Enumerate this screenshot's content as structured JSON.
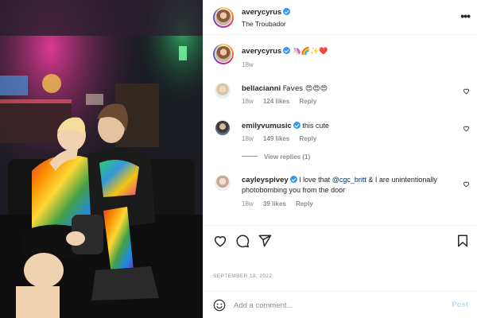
{
  "header": {
    "username": "averycyrus",
    "location": "The Troubador",
    "more_icon": "more-horizontal-icon"
  },
  "caption": {
    "username": "averycyrus",
    "text": "🦄🌈✨❤️",
    "time": "18w"
  },
  "comments": [
    {
      "username": "bellacianni",
      "verified": false,
      "text": "Faves 😍😍😍",
      "time": "18w",
      "likes": "124 likes",
      "reply": "Reply"
    },
    {
      "username": "emilyvumusic",
      "verified": true,
      "text": "this cute",
      "time": "18w",
      "likes": "149 likes",
      "reply": "Reply",
      "view_replies": "View replies (1)"
    },
    {
      "username": "cayleyspivey",
      "verified": true,
      "text_before": "I love that ",
      "mention": "@cgc_britt",
      "text_after": " & I are unintentionally photobombing you from the door",
      "time": "18w",
      "likes": "39 likes",
      "reply": "Reply"
    }
  ],
  "actions": {
    "icons": [
      "heart-icon",
      "comment-icon",
      "share-icon",
      "bookmark-icon"
    ]
  },
  "date": "SEPTEMBER 18, 2022",
  "add_comment": {
    "placeholder": "Add a comment...",
    "post_label": "Post"
  },
  "colors": {
    "verified": "#3897f0",
    "link": "#00376b",
    "muted": "#8e8e8e",
    "post_disabled": "#b2dffc"
  }
}
